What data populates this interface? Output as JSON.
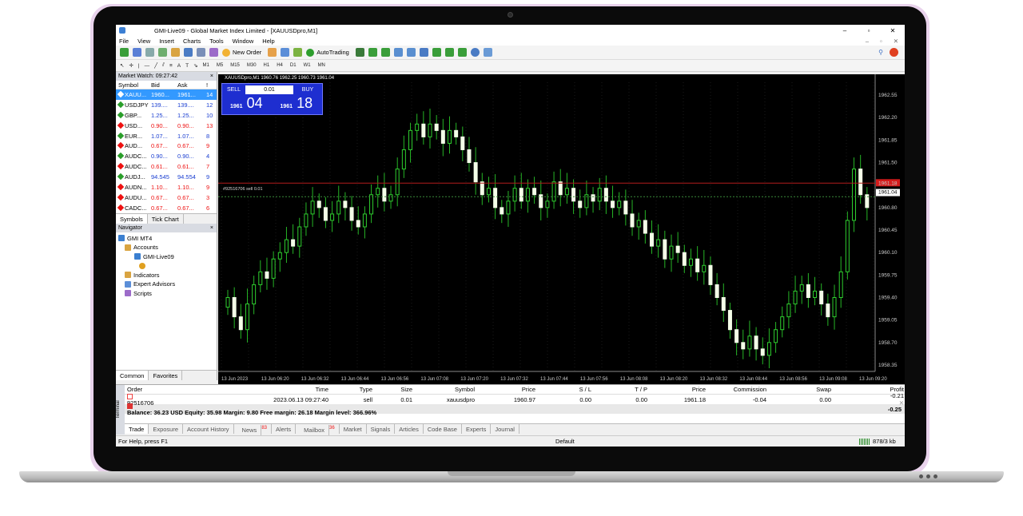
{
  "window": {
    "title": "GMI-Live09 - Global Market Index Limited - [XAUUSDpro,M1]",
    "controls": [
      "–",
      "▫",
      "✕"
    ]
  },
  "menu": [
    "File",
    "View",
    "Insert",
    "Charts",
    "Tools",
    "Window",
    "Help"
  ],
  "menu_right": [
    "–",
    "▫",
    "✕"
  ],
  "toolbar": {
    "new_order": "New Order",
    "autotrading": "AutoTrading"
  },
  "timeframes": [
    "M1",
    "M5",
    "M15",
    "M30",
    "H1",
    "H4",
    "D1",
    "W1",
    "MN"
  ],
  "market_watch": {
    "title": "Market Watch: 09:27:42",
    "headers": [
      "Symbol",
      "Bid",
      "Ask",
      "!"
    ],
    "rows": [
      {
        "symbol": "XAUU...",
        "bid": "1960...",
        "ask": "1961...",
        "spread": "14",
        "color": "#3399ff",
        "selected": true
      },
      {
        "symbol": "USDJPY",
        "bid": "139....",
        "ask": "139....",
        "spread": "12",
        "color": "#1b3fd1"
      },
      {
        "symbol": "GBP...",
        "bid": "1.25...",
        "ask": "1.25...",
        "spread": "10",
        "color": "#1b3fd1"
      },
      {
        "symbol": "USD...",
        "bid": "0.90...",
        "ask": "0.90...",
        "spread": "13",
        "color": "#e11"
      },
      {
        "symbol": "EUR...",
        "bid": "1.07...",
        "ask": "1.07...",
        "spread": "8",
        "color": "#1b3fd1"
      },
      {
        "symbol": "AUD...",
        "bid": "0.67...",
        "ask": "0.67...",
        "spread": "9",
        "color": "#e11"
      },
      {
        "symbol": "AUDC...",
        "bid": "0.90...",
        "ask": "0.90...",
        "spread": "4",
        "color": "#1b3fd1"
      },
      {
        "symbol": "AUDC...",
        "bid": "0.61...",
        "ask": "0.61...",
        "spread": "7",
        "color": "#e11"
      },
      {
        "symbol": "AUDJ...",
        "bid": "94.545",
        "ask": "94.554",
        "spread": "9",
        "color": "#1b3fd1"
      },
      {
        "symbol": "AUDN...",
        "bid": "1.10...",
        "ask": "1.10...",
        "spread": "9",
        "color": "#e11"
      },
      {
        "symbol": "AUDU...",
        "bid": "0.67...",
        "ask": "0.67...",
        "spread": "3",
        "color": "#e11"
      },
      {
        "symbol": "CADC...",
        "bid": "0.67...",
        "ask": "0.67...",
        "spread": "6",
        "color": "#e11"
      }
    ],
    "tabs": [
      "Symbols",
      "Tick Chart"
    ]
  },
  "navigator": {
    "title": "Navigator",
    "items": [
      "GMI MT4",
      "Accounts",
      "GMI-Live09",
      "",
      "Indicators",
      "Expert Advisors",
      "Scripts"
    ],
    "tabs": [
      "Common",
      "Favorites"
    ]
  },
  "chart": {
    "symbol_info": "XAUUSDpro,M1  1960.76 1962.25 1960.73 1961.04",
    "order_line_label": "#92516706 sell 0.01",
    "trade_panel": {
      "sell": "SELL",
      "buy": "BUY",
      "lot": "0.01",
      "bid_prefix": "1961",
      "bid_big": "04",
      "ask_prefix": "1961",
      "ask_big": "18"
    },
    "price_labels": [
      "1962.55",
      "1962.20",
      "1961.85",
      "1961.50",
      "1961.18",
      "1961.04",
      "1960.80",
      "1960.45",
      "1960.10",
      "1959.75",
      "1959.40",
      "1959.05",
      "1958.70",
      "1958.35"
    ],
    "time_labels": [
      "13 Jun 2023",
      "13 Jun 06:20",
      "13 Jun 06:32",
      "13 Jun 06:44",
      "13 Jun 06:56",
      "13 Jun 07:08",
      "13 Jun 07:20",
      "13 Jun 07:32",
      "13 Jun 07:44",
      "13 Jun 07:56",
      "13 Jun 08:08",
      "13 Jun 08:20",
      "13 Jun 08:32",
      "13 Jun 08:44",
      "13 Jun 08:56",
      "13 Jun 09:08",
      "13 Jun 09:20"
    ]
  },
  "chart_data": {
    "type": "candlestick",
    "symbol": "XAUUSDpro",
    "timeframe": "M1",
    "ylim": [
      1958.25,
      1962.75
    ],
    "bid_line": 1961.04,
    "ask_line": 1961.18,
    "order_line": 1960.97,
    "close": [
      1959.4,
      1959.1,
      1958.9,
      1959.3,
      1959.6,
      1959.8,
      1959.7,
      1960.0,
      1960.1,
      1960.3,
      1960.2,
      1960.5,
      1960.7,
      1960.9,
      1960.8,
      1960.6,
      1960.7,
      1960.9,
      1960.8,
      1960.6,
      1960.5,
      1960.7,
      1961.0,
      1961.1,
      1960.9,
      1961.0,
      1961.4,
      1961.7,
      1962.0,
      1962.1,
      1961.9,
      1962.1,
      1962.0,
      1961.8,
      1962.0,
      1961.9,
      1961.7,
      1961.5,
      1961.2,
      1961.0,
      1961.1,
      1960.8,
      1960.7,
      1960.9,
      1961.1,
      1960.9,
      1961.1,
      1961.0,
      1960.8,
      1960.9,
      1961.2,
      1961.0,
      1961.1,
      1960.9,
      1960.8,
      1961.0,
      1960.9,
      1961.1,
      1960.9,
      1960.8,
      1960.9,
      1960.7,
      1960.5,
      1960.6,
      1960.4,
      1960.2,
      1960.3,
      1960.0,
      1960.2,
      1960.1,
      1959.9,
      1960.0,
      1959.8,
      1959.9,
      1959.6,
      1959.4,
      1959.2,
      1958.9,
      1958.7,
      1958.6,
      1958.8,
      1958.6,
      1958.5,
      1958.7,
      1958.9,
      1959.1,
      1959.3,
      1959.5,
      1959.6,
      1959.4,
      1959.5,
      1959.3,
      1959.1,
      1959.4,
      1959.8,
      1960.6,
      1961.4,
      1961.0,
      1960.8
    ]
  },
  "terminal": {
    "side_label": "Terminal",
    "headers": [
      "Order",
      "Time",
      "Type",
      "Size",
      "Symbol",
      "Price",
      "S / L",
      "T / P",
      "Price",
      "Commission",
      "Swap",
      "Profit"
    ],
    "order": [
      "92516706",
      "2023.06.13 09:27:40",
      "sell",
      "0.01",
      "xauusdpro",
      "1960.97",
      "0.00",
      "0.00",
      "1961.18",
      "-0.04",
      "0.00",
      "-0.21"
    ],
    "balance_line": "Balance: 36.23 USD  Equity: 35.98  Margin: 9.80  Free margin: 26.18  Margin level: 366.96%",
    "balance_profit": "-0.25",
    "tabs": [
      "Trade",
      "Exposure",
      "Account History",
      "News",
      "Alerts",
      "Mailbox",
      "Market",
      "Signals",
      "Articles",
      "Code Base",
      "Experts",
      "Journal"
    ],
    "news_count": "83",
    "mailbox_count": "36"
  },
  "status": {
    "help": "For Help, press F1",
    "profile": "Default",
    "traffic": "878/3 kb"
  }
}
